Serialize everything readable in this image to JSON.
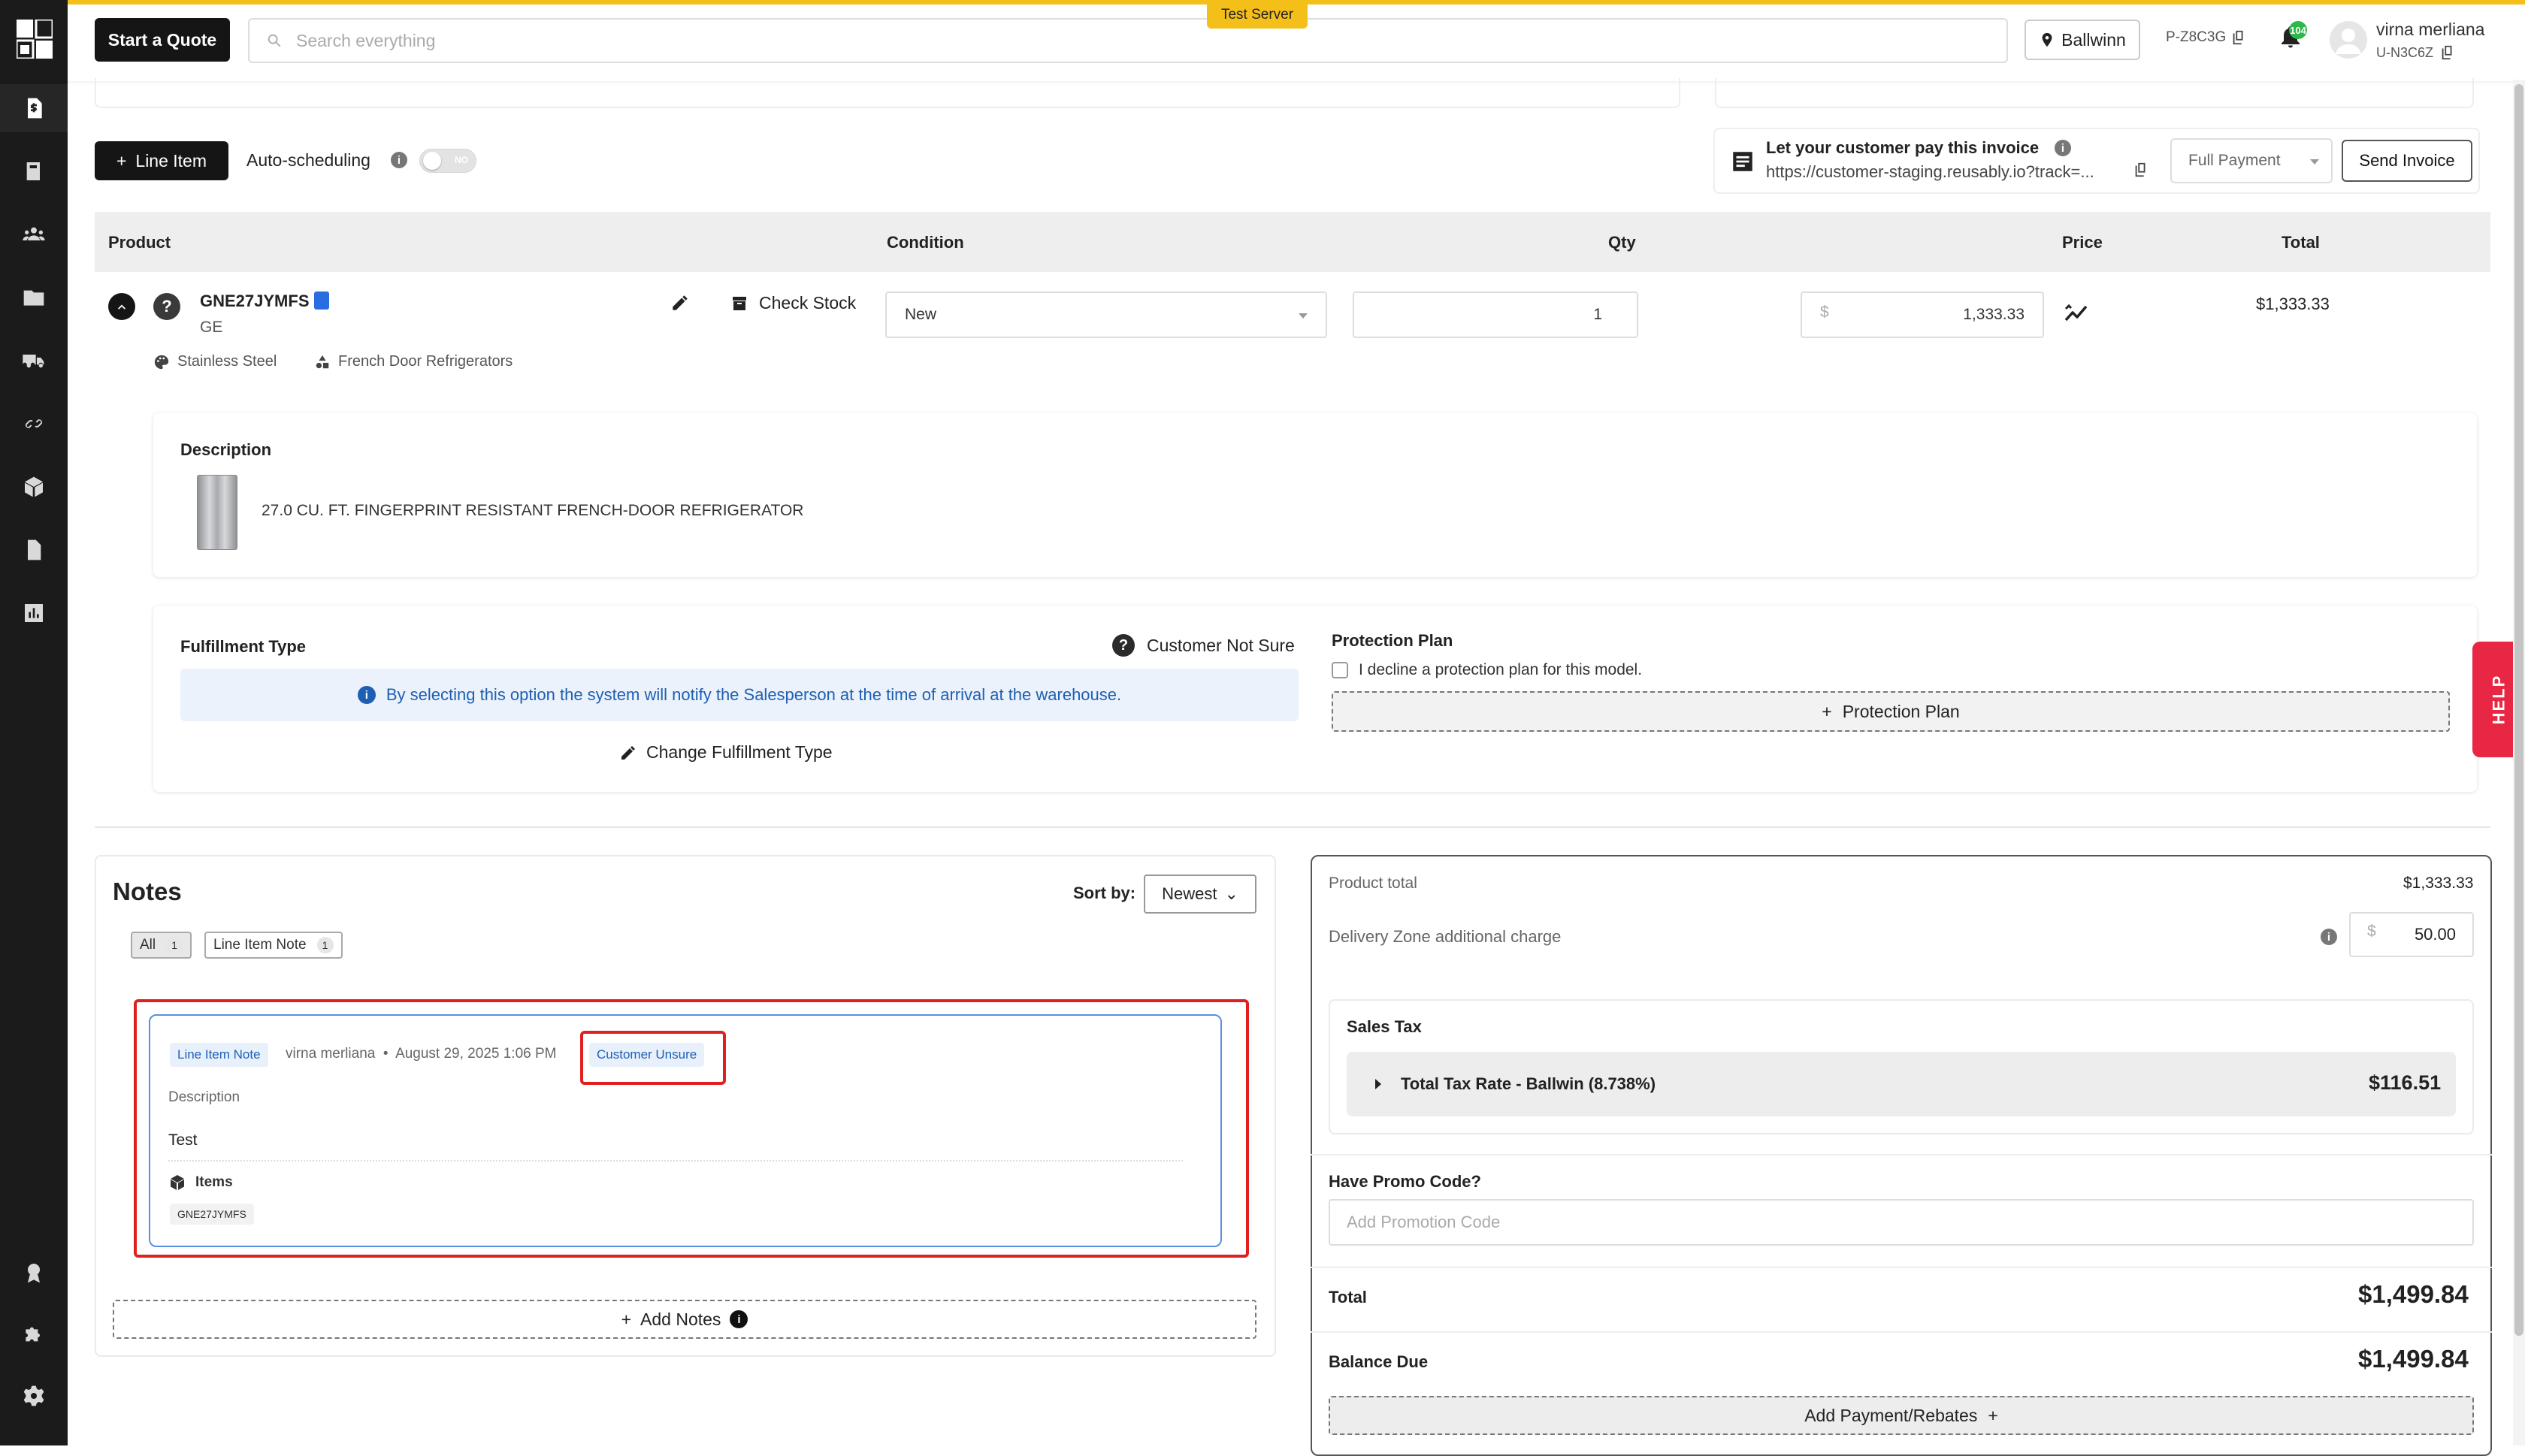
{
  "topbar": {
    "quote_button": "Start a Quote",
    "search_placeholder": "Search everything",
    "server_badge": "Test Server",
    "location": "Ballwinn",
    "store_code": "P-Z8C3G",
    "notification_count": "104",
    "user_name": "virna merliana",
    "user_code": "U-N3C6Z",
    "accent_color": "#f5bf1a"
  },
  "sidebar": {
    "items": [
      "dollar-document-icon",
      "book-icon",
      "people-icon",
      "folder-icon",
      "truck-icon",
      "link-icon",
      "box-icon",
      "document-icon",
      "chart-icon",
      "award-icon",
      "puzzle-icon",
      "gear-icon"
    ],
    "active": "dollar-document-icon"
  },
  "toolbar": {
    "line_item_button": "Line Item",
    "auto_scheduling_label": "Auto-scheduling",
    "toggle_text": "NO"
  },
  "invoice": {
    "title": "Let your customer pay this invoice",
    "url": "https://customer-staging.reusably.io?track=...",
    "payment_option": "Full Payment",
    "send_button": "Send Invoice"
  },
  "table": {
    "headers": [
      "Product",
      "Condition",
      "Qty",
      "Price",
      "Total"
    ]
  },
  "product": {
    "model": "GNE27JYMFS",
    "brand": "GE",
    "check_stock": "Check Stock",
    "finish": "Stainless Steel",
    "category": "French Door Refrigerators",
    "condition": "New",
    "qty": "1",
    "price_symbol": "$",
    "price": "1,333.33",
    "total": "$1,333.33",
    "description_label": "Description",
    "description": "27.0 CU. FT. FINGERPRINT RESISTANT FRENCH-DOOR REFRIGERATOR"
  },
  "fulfillment": {
    "label": "Fulfillment Type",
    "status": "Customer Not Sure",
    "notice": "By selecting this option the system will notify the Salesperson at the time of arrival at the warehouse.",
    "change_button": "Change Fulfillment Type"
  },
  "protection": {
    "label": "Protection Plan",
    "decline_text": "I decline a protection plan for this model.",
    "add_button": "Protection Plan"
  },
  "help_tab": "HELP",
  "notes": {
    "title": "Notes",
    "sort_label": "Sort by:",
    "sort_value": "Newest",
    "filters": [
      {
        "label": "All",
        "count": "1"
      },
      {
        "label": "Line Item Note",
        "count": "1"
      }
    ],
    "note": {
      "type": "Line Item Note",
      "author": "virna merliana",
      "date": "August 29, 2025 1:06 PM",
      "status": "Customer Unsure",
      "description_label": "Description",
      "text": "Test",
      "items_label": "Items",
      "item": "GNE27JYMFS"
    },
    "add_button": "Add Notes"
  },
  "summary": {
    "product_total_label": "Product total",
    "product_total": "$1,333.33",
    "delivery_label": "Delivery Zone additional charge",
    "delivery_symbol": "$",
    "delivery_value": "50.00",
    "sales_tax_label": "Sales Tax",
    "tax_rate_label": "Total Tax Rate - Ballwin (8.738%)",
    "tax_value": "$116.51",
    "promo_label": "Have Promo Code?",
    "promo_placeholder": "Add Promotion Code",
    "total_label": "Total",
    "total": "$1,499.84",
    "balance_label": "Balance Due",
    "balance": "$1,499.84",
    "add_payment_button": "Add Payment/Rebates"
  }
}
